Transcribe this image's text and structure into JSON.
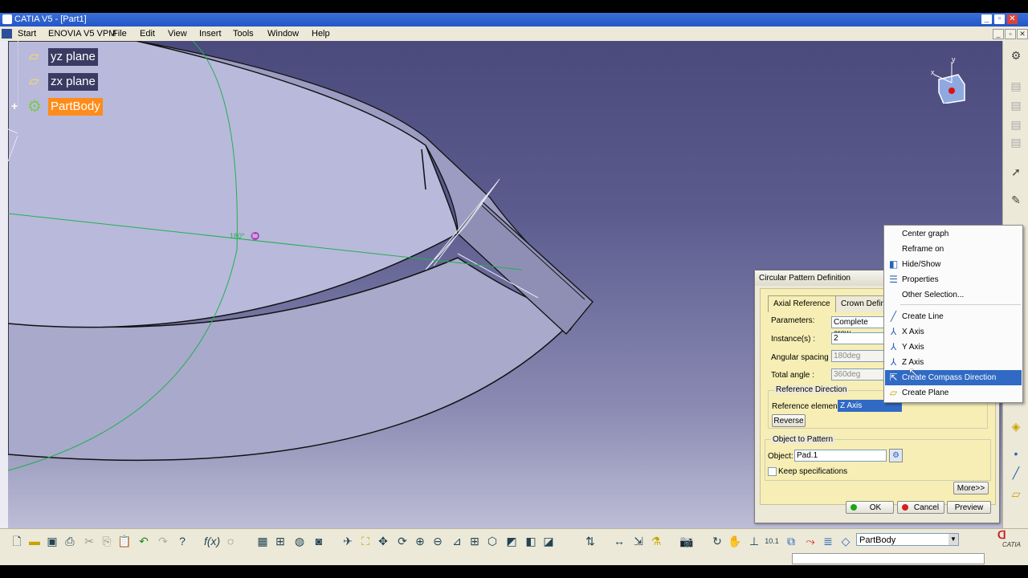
{
  "window": {
    "title": "CATIA V5 - [Part1]"
  },
  "menubar": {
    "items": [
      "Start",
      "ENOVIA V5 VPM",
      "File",
      "Edit",
      "View",
      "Insert",
      "Tools",
      "Window",
      "Help"
    ]
  },
  "tree": {
    "items": [
      {
        "label": "yz plane",
        "icon": "plane-icon"
      },
      {
        "label": "zx plane",
        "icon": "plane-icon"
      },
      {
        "label": "PartBody",
        "icon": "partbody-icon",
        "selected": true
      }
    ]
  },
  "viewport": {
    "angle_label": "180°",
    "compass_axes": {
      "x": "x",
      "y": "y"
    }
  },
  "dialog": {
    "title": "Circular Pattern Definition",
    "tabs": [
      "Axial Reference",
      "Crown Defin"
    ],
    "parameters_label": "Parameters:",
    "parameters_value": "Complete crow",
    "instances_label": "Instance(s) :",
    "instances_value": "2",
    "angular_spacing_label": "Angular spacing :",
    "angular_spacing_value": "180deg",
    "total_angle_label": "Total angle :",
    "total_angle_value": "360deg",
    "reference_direction_group": "Reference Direction",
    "reference_element_label": "Reference element:",
    "reference_element_value": "Z Axis",
    "reverse_button": "Reverse",
    "object_group": "Object to Pattern",
    "object_label": "Object:",
    "object_value": "Pad.1",
    "keep_specs_label": "Keep specifications",
    "keep_specs_checked": false,
    "more_button": "More>>",
    "ok_button": "OK",
    "cancel_button": "Cancel",
    "preview_button": "Preview"
  },
  "context_menu": {
    "items": [
      {
        "label": "Center graph",
        "icon": ""
      },
      {
        "label": "Reframe on",
        "icon": ""
      },
      {
        "label": "Hide/Show",
        "icon": "hide-show-icon"
      },
      {
        "label": "Properties",
        "icon": "properties-icon"
      },
      {
        "label": "Other Selection...",
        "icon": ""
      },
      {
        "label": "Create Line",
        "icon": "line-icon"
      },
      {
        "label": "X Axis",
        "icon": "axis-icon"
      },
      {
        "label": "Y Axis",
        "icon": "axis-icon"
      },
      {
        "label": "Z Axis",
        "icon": "axis-icon"
      },
      {
        "label": "Create Compass Direction",
        "icon": "compass-icon",
        "selected": true
      },
      {
        "label": "Create Plane",
        "icon": "plane-icon"
      }
    ]
  },
  "toolbar": {
    "current_body": "PartBody"
  },
  "brand": {
    "logo_text": "CATIA"
  },
  "colors": {
    "titlebar": "#2456c8",
    "selection": "#316ac5",
    "partbody_highlight": "#ff8c1a",
    "viewport_top": "#4a4a7c",
    "viewport_bottom": "#bdbdd6"
  }
}
